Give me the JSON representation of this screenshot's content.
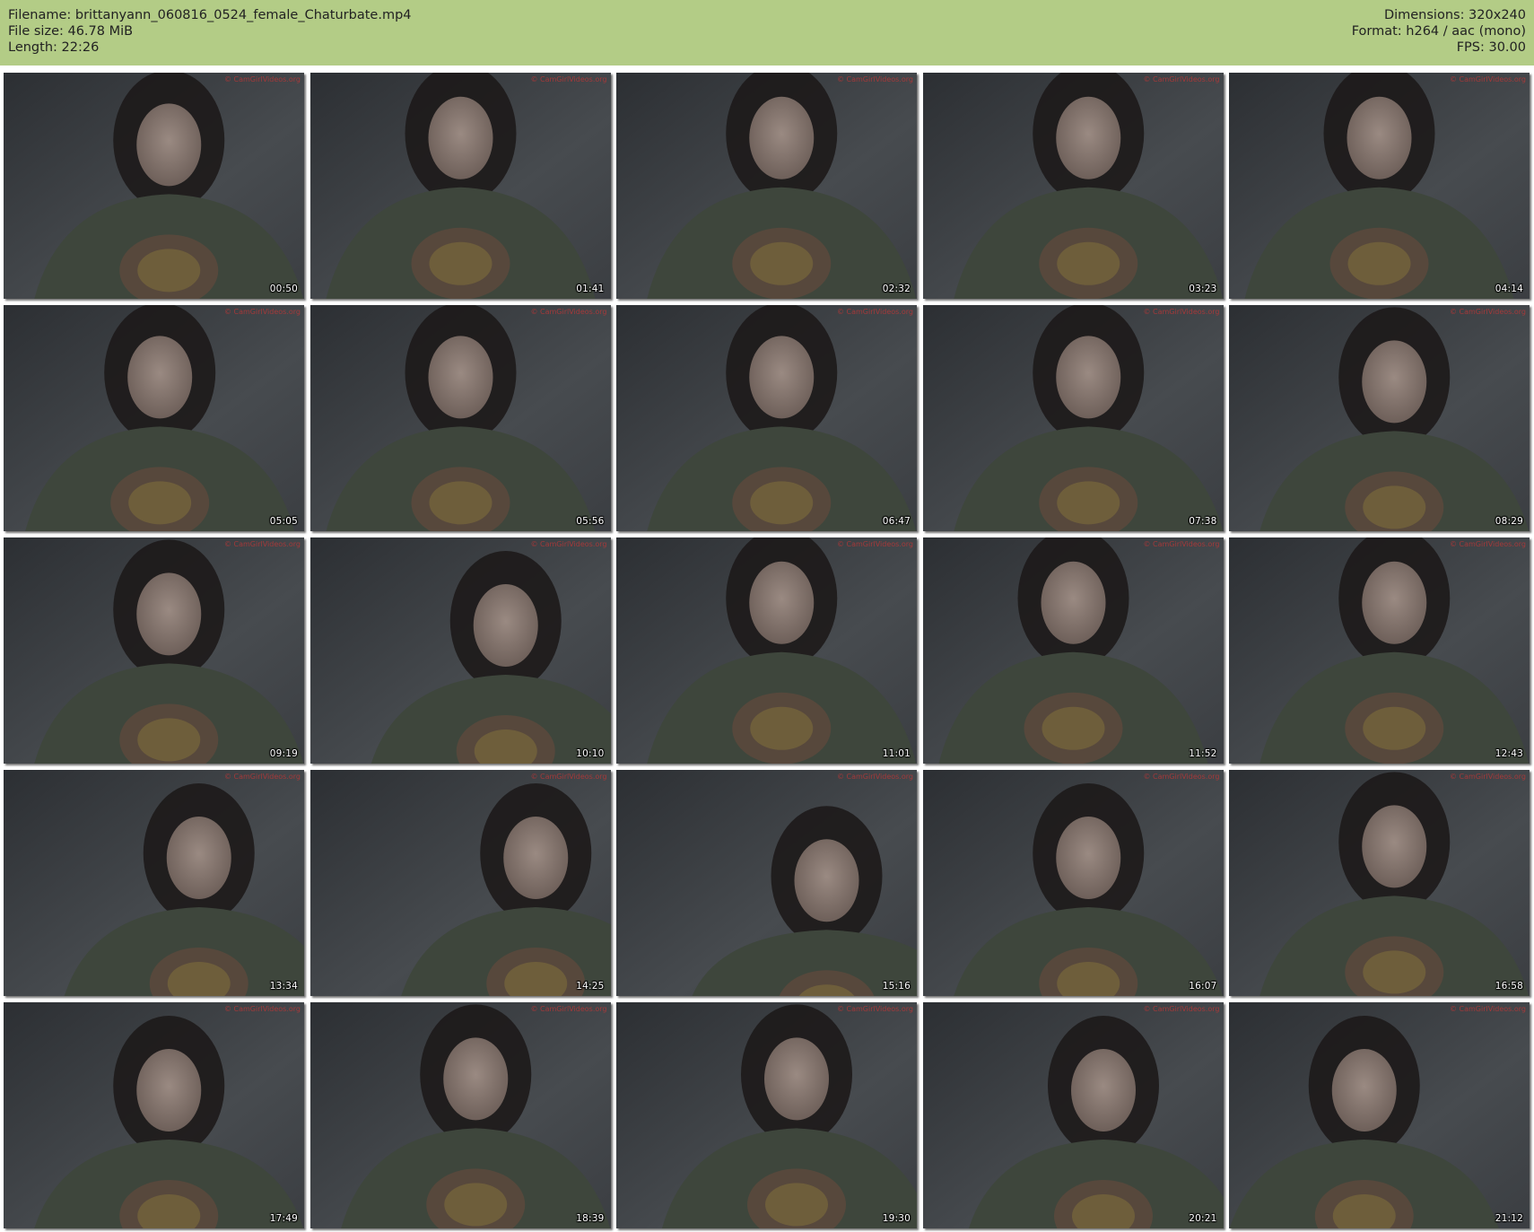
{
  "header": {
    "filename_label": "Filename: brittanyann_060816_0524_female_Chaturbate.mp4",
    "filesize_label": "File size: 46.78 MiB",
    "length_label": "Length: 22:26",
    "dimensions_label": "Dimensions: 320x240",
    "format_label": "Format: h264 / aac (mono)",
    "fps_label": "FPS: 30.00",
    "background_color": "#b3cc86"
  },
  "thumbnails": [
    {
      "time": "00:50",
      "watermark": "© CamGirlVideos.org"
    },
    {
      "time": "01:41",
      "watermark": "© CamGirlVideos.org"
    },
    {
      "time": "02:32",
      "watermark": "© CamGirlVideos.org"
    },
    {
      "time": "03:23",
      "watermark": "© CamGirlVideos.org"
    },
    {
      "time": "04:14",
      "watermark": "© CamGirlVideos.org"
    },
    {
      "time": "05:05",
      "watermark": "© CamGirlVideos.org"
    },
    {
      "time": "05:56",
      "watermark": "© CamGirlVideos.org"
    },
    {
      "time": "06:47",
      "watermark": "© CamGirlVideos.org"
    },
    {
      "time": "07:38",
      "watermark": "© CamGirlVideos.org"
    },
    {
      "time": "08:29",
      "watermark": "© CamGirlVideos.org"
    },
    {
      "time": "09:19",
      "watermark": "© CamGirlVideos.org"
    },
    {
      "time": "10:10",
      "watermark": "© CamGirlVideos.org"
    },
    {
      "time": "11:01",
      "watermark": "© CamGirlVideos.org"
    },
    {
      "time": "11:52",
      "watermark": "© CamGirlVideos.org"
    },
    {
      "time": "12:43",
      "watermark": "© CamGirlVideos.org"
    },
    {
      "time": "13:34",
      "watermark": "© CamGirlVideos.org"
    },
    {
      "time": "14:25",
      "watermark": "© CamGirlVideos.org"
    },
    {
      "time": "15:16",
      "watermark": "© CamGirlVideos.org"
    },
    {
      "time": "16:07",
      "watermark": "© CamGirlVideos.org"
    },
    {
      "time": "16:58",
      "watermark": "© CamGirlVideos.org"
    },
    {
      "time": "17:49",
      "watermark": "© CamGirlVideos.org"
    },
    {
      "time": "18:39",
      "watermark": "© CamGirlVideos.org"
    },
    {
      "time": "19:30",
      "watermark": "© CamGirlVideos.org"
    },
    {
      "time": "20:21",
      "watermark": "© CamGirlVideos.org"
    },
    {
      "time": "21:12",
      "watermark": "© CamGirlVideos.org"
    }
  ]
}
